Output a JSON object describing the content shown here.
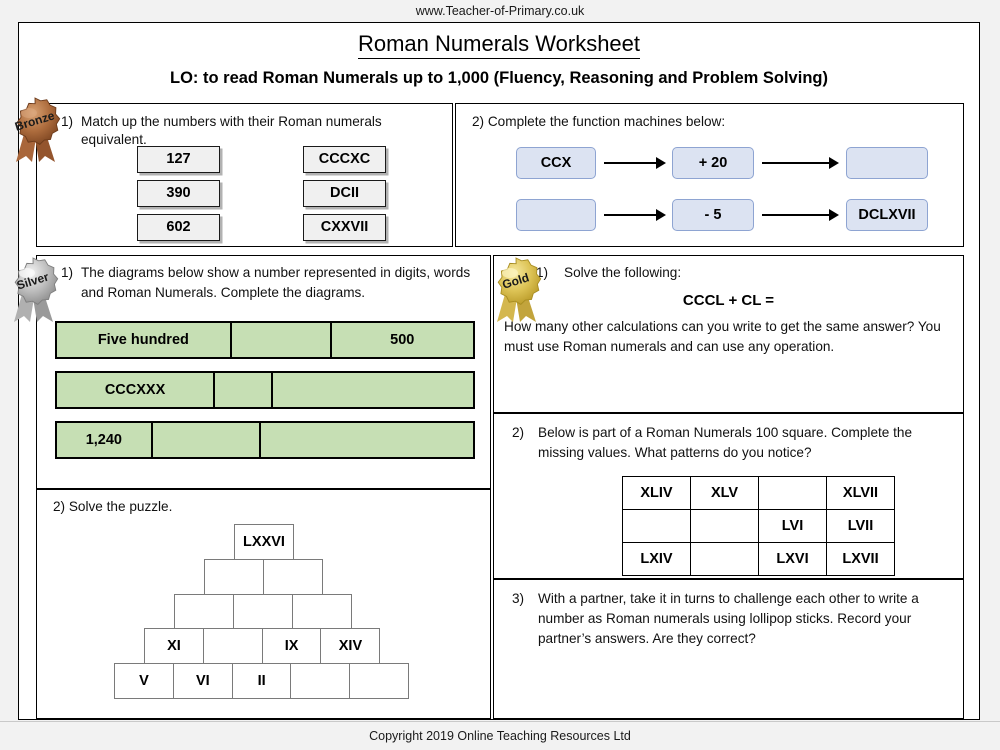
{
  "site_url": "www.Teacher-of-Primary.co.uk",
  "title": "Roman Numerals Worksheet",
  "learning_objective": "LO: to read Roman Numerals up to 1,000 (Fluency, Reasoning and Problem Solving)",
  "footer": "Copyright 2019 Online Teaching Resources Ltd",
  "medals": {
    "bronze": "Bronze",
    "silver": "Silver",
    "gold": "Gold"
  },
  "colors": {
    "green_fill": "#c6dfb4",
    "blue_fill": "#dce3f2",
    "blue_border": "#8ea4d2",
    "grey_fill": "#f0f0f0",
    "page_bg": "#f2f2f2"
  },
  "bronze": {
    "q1_number": "1)",
    "q1_text": "Match up the numbers with their Roman numerals equivalent.",
    "numbers": [
      "127",
      "390",
      "602"
    ],
    "numerals": [
      "CCCXC",
      "DCII",
      "CXXVII"
    ]
  },
  "function_machines": {
    "q2_text": "2) Complete the function machines below:",
    "rows": [
      {
        "input": "CCX",
        "operation": "+ 20",
        "output": ""
      },
      {
        "input": "",
        "operation": "- 5",
        "output": "DCLXVII"
      }
    ]
  },
  "silver": {
    "q1_number": "1)",
    "q1_text_line1": "The diagrams below show a number represented in digits, words",
    "q1_text_line2": "and Roman Numerals. Complete the diagrams.",
    "bars": [
      {
        "cells": [
          "Five hundred",
          "",
          "500"
        ],
        "widths": [
          42,
          24,
          34
        ]
      },
      {
        "cells": [
          "CCCXXX",
          "",
          ""
        ],
        "widths": [
          38,
          14,
          48
        ]
      },
      {
        "cells": [
          "1,240",
          "",
          ""
        ],
        "widths": [
          23,
          26,
          51
        ]
      }
    ],
    "q2_text": "2) Solve the puzzle.",
    "pyramid_rows": [
      [
        "LXXVI"
      ],
      [
        "",
        ""
      ],
      [
        "",
        "",
        ""
      ],
      [
        "XI",
        "",
        "IX",
        "XIV"
      ],
      [
        "V",
        "VI",
        "II",
        "",
        ""
      ]
    ]
  },
  "gold": {
    "q1_number": "1)",
    "q1_text": "Solve the following:",
    "q1_calculation": "CCCL + CL =",
    "q1_followup_line1": "How many other calculations can you write to get the same answer? You",
    "q1_followup_line2": "must use Roman numerals and can use any operation.",
    "q2_number": "2)",
    "q2_text_line1": "Below is part of a Roman Numerals 100 square. Complete the",
    "q2_text_line2": "missing values. What patterns do you notice?",
    "hundred_square": [
      [
        "XLIV",
        "XLV",
        "",
        "XLVII"
      ],
      [
        "",
        "",
        "LVI",
        "LVII"
      ],
      [
        "LXIV",
        "",
        "LXVI",
        "LXVII"
      ]
    ],
    "q3_number": "3)",
    "q3_text_line1": "With a partner, take it in turns to challenge each other to write a",
    "q3_text_line2": "number as Roman numerals using lollipop sticks. Record your",
    "q3_text_line3": "partner’s answers. Are they correct?"
  }
}
